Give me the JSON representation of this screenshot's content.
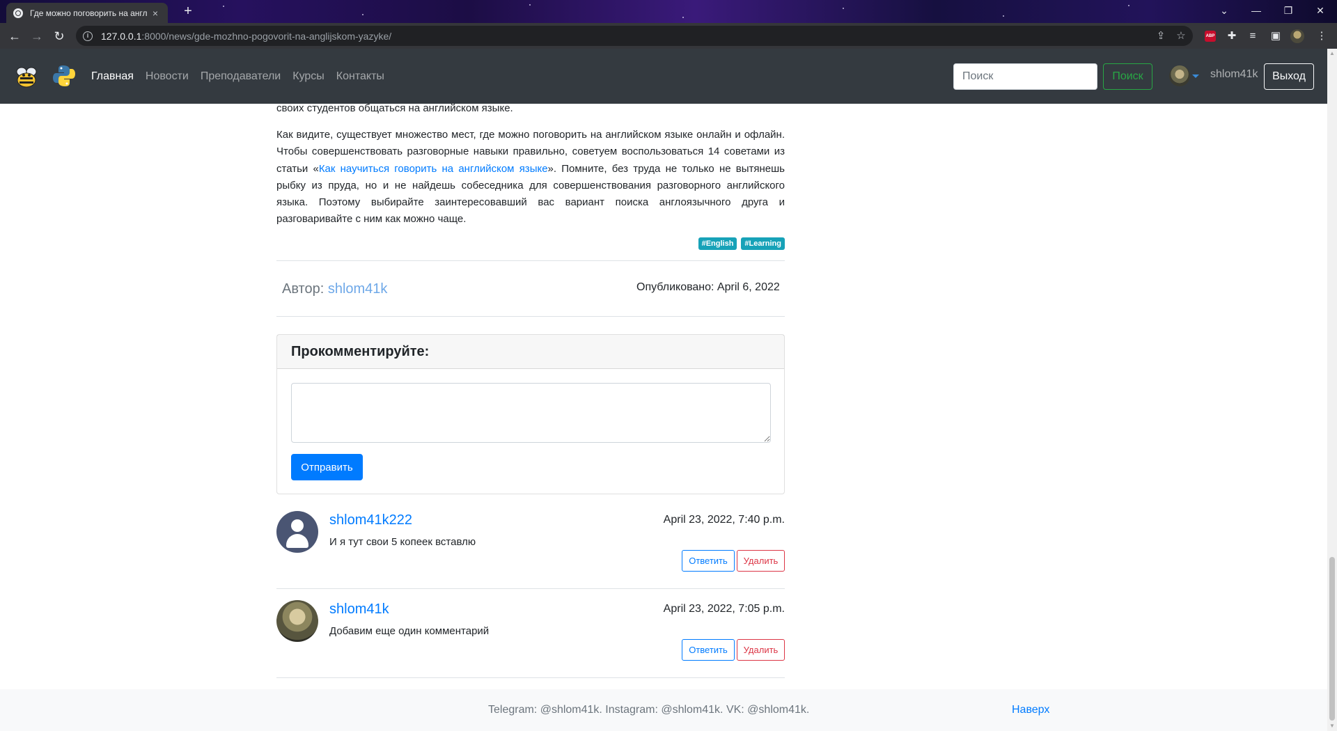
{
  "browser": {
    "tab_title": "Где можно поговорить на англ",
    "tab_close": "×",
    "new_tab": "+",
    "url_host": "127.0.0.1",
    "url_path": ":8000/news/gde-mozhno-pogovorit-na-anglijskom-yazyke/",
    "icons": [
      "globe-icon",
      "back-icon",
      "forward-icon",
      "reload-icon",
      "info-icon",
      "share-icon",
      "star-icon",
      "adblock-icon",
      "extensions-icon",
      "reading-list-icon",
      "sidepanel-icon",
      "profile-icon",
      "menu-icon"
    ]
  },
  "navbar": {
    "links": [
      {
        "label": "Главная",
        "active": true
      },
      {
        "label": "Новости"
      },
      {
        "label": "Преподаватели"
      },
      {
        "label": "Курсы"
      },
      {
        "label": "Контакты"
      }
    ],
    "search_placeholder": "Поиск",
    "search_button": "Поиск",
    "username": "shlom41k",
    "logout_button": "Выход"
  },
  "article": {
    "cut_paragraph_tail": "своих студентов общаться на английском языке.",
    "paragraph_before_link": "Как видите, существует множество мест, где можно поговорить на английском языке онлайн и офлайн. Чтобы совершенствовать разговорные навыки правильно, советуем воспользоваться 14 советами из статьи «",
    "paragraph_link": "Как научиться говорить на английском языке",
    "paragraph_after_link": "». Помните, без труда не только не вытянешь рыбку из пруда, но и не найдешь собеседника для совершенствования разговорного английского языка. Поэтому выбирайте заинтересовавший вас вариант поиска англоязычного друга и разговаривайте с ним как можно чаще.",
    "tags": [
      "#English",
      "#Learning"
    ],
    "author_label": "Автор:",
    "author_name": "shlom41k",
    "published": "Опубликовано: April 6, 2022"
  },
  "comment_form": {
    "title": "Прокомментируйте:",
    "textarea_value": "",
    "submit_button": "Отправить"
  },
  "comments": [
    {
      "author": "shlom41k222",
      "date": "April 23, 2022, 7:40 p.m.",
      "text": "И я тут свои 5 копеек вставлю",
      "reply": "Ответить",
      "delete": "Удалить"
    },
    {
      "author": "shlom41k",
      "date": "April 23, 2022, 7:05 p.m.",
      "text": "Добавим еще один комментарий",
      "reply": "Ответить",
      "delete": "Удалить"
    }
  ],
  "footer": {
    "text": "Telegram: @shlom41k. Instagram: @shlom41k. VK: @shlom41k.",
    "back_to_top": "Наверх"
  },
  "colors": {
    "navbar": "#343a40",
    "primary": "#007bff",
    "success": "#28a745",
    "danger": "#dc3545",
    "tag": "#17a2b8"
  }
}
